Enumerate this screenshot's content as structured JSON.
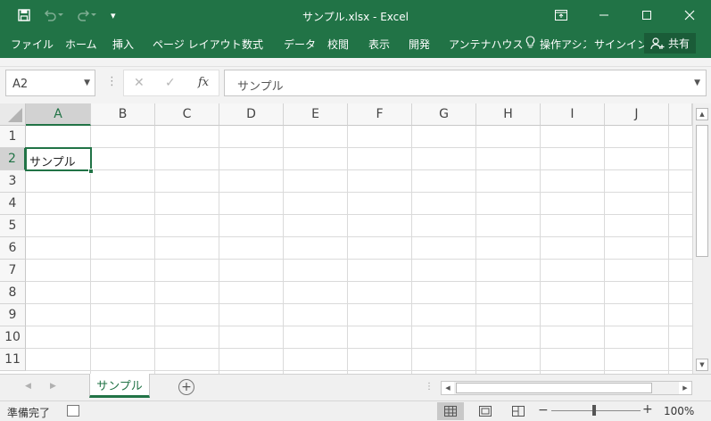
{
  "app": {
    "window_title": "サンプル.xlsx - Excel",
    "qat": {
      "customize_glyph": "▾"
    }
  },
  "ribbon_tabs": [
    {
      "label": "ファイル"
    },
    {
      "label": "ホーム"
    },
    {
      "label": "挿入"
    },
    {
      "label": "ページ レイアウト"
    },
    {
      "label": "数式"
    },
    {
      "label": "データ"
    },
    {
      "label": "校閲"
    },
    {
      "label": "表示"
    },
    {
      "label": "開発"
    },
    {
      "label": "アンテナハウス"
    },
    {
      "label": "操作アシス"
    },
    {
      "label": "サインイン"
    }
  ],
  "share": {
    "label": "共有"
  },
  "formula_bar": {
    "name_box": "A2",
    "fx_label": "fx",
    "formula": "サンプル"
  },
  "sheet": {
    "columns": [
      "A",
      "B",
      "C",
      "D",
      "E",
      "F",
      "G",
      "H",
      "I",
      "J"
    ],
    "rows": [
      "1",
      "2",
      "3",
      "4",
      "5",
      "6",
      "7",
      "8",
      "9",
      "10",
      "11"
    ],
    "selected_column": "A",
    "selected_row": "2",
    "cells": {
      "A2": "サンプル"
    }
  },
  "sheet_tabs": [
    {
      "label": "サンプル",
      "active": true
    }
  ],
  "status": {
    "ready": "準備完了",
    "zoom": "100%",
    "zoom_level": 1.0,
    "active_view": "normal"
  },
  "colors": {
    "accent": "#217346",
    "share_bg": "#1a5c38",
    "header_selected": "#d2d2d2"
  }
}
